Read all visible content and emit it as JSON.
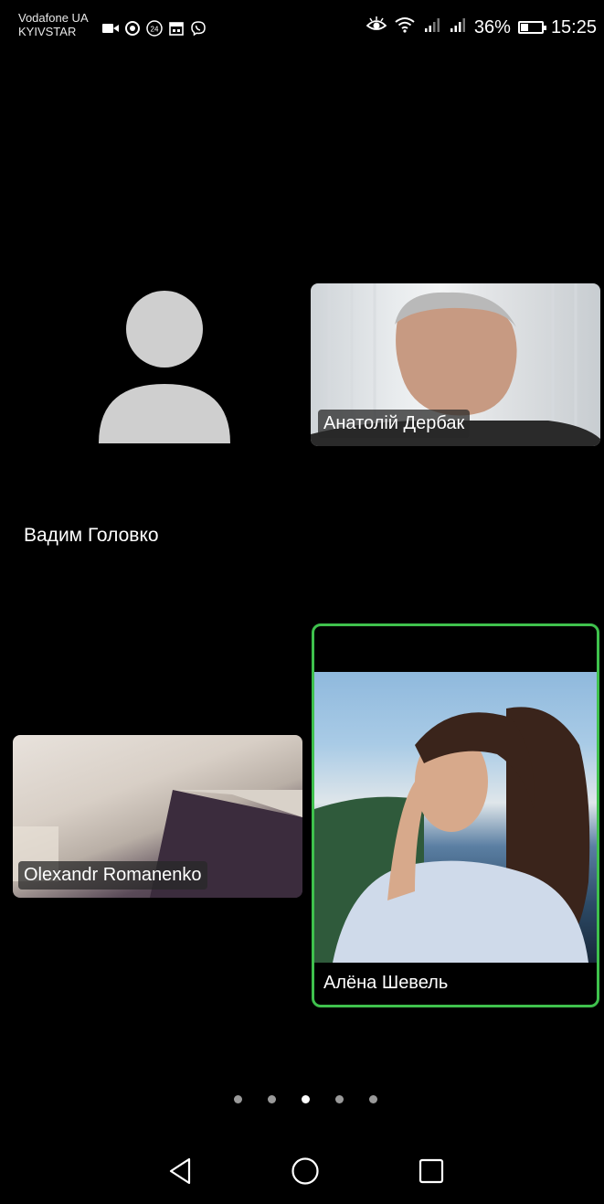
{
  "status_bar": {
    "carrier_line1": "Vodafone UA",
    "carrier_line2": "KYIVSTAR",
    "battery_percent": "36%",
    "battery_level": 0.36,
    "time": "15:25",
    "icons": [
      "video-camera-icon",
      "chrome-icon",
      "badge-24-icon",
      "calendar-icon",
      "viber-icon",
      "eye-icon",
      "wifi-icon",
      "signal-icon",
      "signal-icon"
    ]
  },
  "participants": [
    {
      "name": "Вадим Головко",
      "video": "off"
    },
    {
      "name": "Анатолій Дербак",
      "video": "on"
    },
    {
      "name": "Olexandr Romanenko",
      "video": "on"
    },
    {
      "name": "Алёна Шевель",
      "video": "on",
      "active_speaker": true
    }
  ],
  "pager": {
    "pages": 5,
    "current": 3
  },
  "nav": {
    "buttons": [
      "back-icon",
      "home-icon",
      "recents-icon"
    ]
  },
  "colors": {
    "background": "#000000",
    "active_speaker_border": "#3fc14d",
    "avatar": "#cfcfcf"
  }
}
